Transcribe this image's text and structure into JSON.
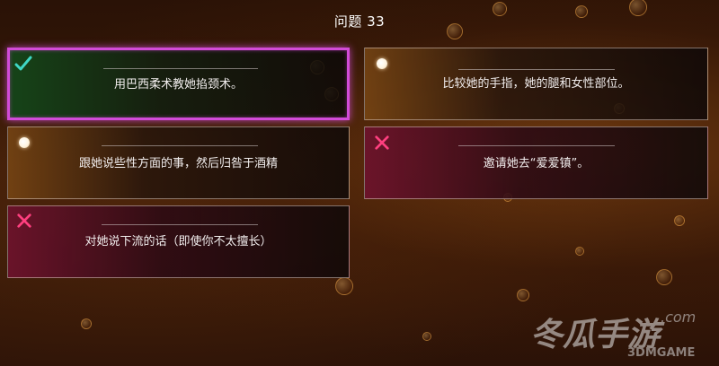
{
  "question": {
    "title": "问题 33"
  },
  "options": [
    {
      "label": "用巴西柔术教她掐颈术。",
      "state": "correct",
      "icon": "check-icon"
    },
    {
      "label": "比较她的手指，她的腿和女性部位。",
      "state": "neutral",
      "icon": "dot-icon"
    },
    {
      "label": "跟她说些性方面的事，然后归咎于酒精",
      "state": "neutral",
      "icon": "dot-icon"
    },
    {
      "label": "邀请她去“爱爱镇”。",
      "state": "wrong",
      "icon": "cross-icon"
    },
    {
      "label": "对她说下流的话（即使你不太擅长）",
      "state": "wrong",
      "icon": "cross-icon"
    }
  ],
  "colors": {
    "correct_border": "#d24bd8",
    "check": "#3fd7c5",
    "cross": "#ff3f7f"
  },
  "watermark": {
    "logo_text": "冬瓜手游",
    "domain": ".com",
    "sub": "3DMGAME"
  }
}
